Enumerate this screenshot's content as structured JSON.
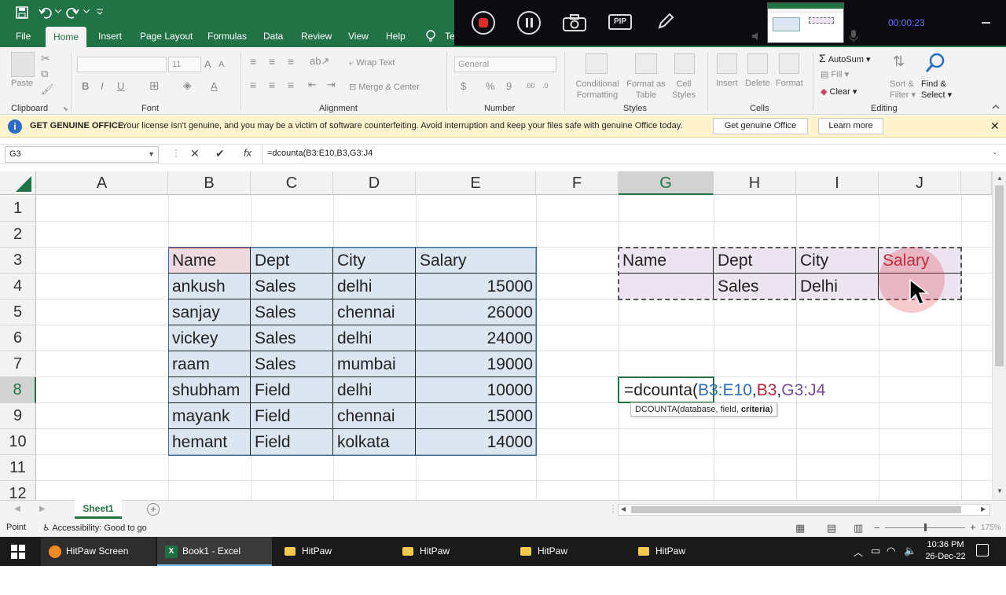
{
  "quick_access": {
    "save_icon": "save-icon",
    "undo_icon": "undo-icon",
    "redo_icon": "redo-icon"
  },
  "tabs": [
    "File",
    "Home",
    "Insert",
    "Page Layout",
    "Formulas",
    "Data",
    "Review",
    "View",
    "Help",
    "Te"
  ],
  "recorder": {
    "pip_label": "PIP",
    "timer": "00:00:23"
  },
  "ribbon": {
    "clipboard": {
      "label": "Clipboard",
      "paste": "Paste"
    },
    "font": {
      "label": "Font",
      "size": "11"
    },
    "alignment": {
      "label": "Alignment",
      "wrap": "Wrap Text",
      "merge": "Merge & Center"
    },
    "number": {
      "label": "Number",
      "format": "General"
    },
    "styles": {
      "label": "Styles",
      "conditional": "Conditional",
      "conditional2": "Formatting",
      "format_as": "Format as",
      "format_as2": "Table",
      "cell_styles": "Cell",
      "cell_styles2": "Styles"
    },
    "cells": {
      "label": "Cells",
      "insert": "Insert",
      "delete": "Delete",
      "format": "Format"
    },
    "editing": {
      "label": "Editing",
      "autosum": "AutoSum",
      "fill": "Fill",
      "clear": "Clear",
      "sort": "Sort &",
      "sort2": "Filter",
      "find": "Find &",
      "find2": "Select"
    }
  },
  "message": {
    "title": "GET GENUINE OFFICE",
    "text": "Your license isn't genuine, and you may be a victim of software counterfeiting. Avoid interruption and keep your files safe with genuine Office today.",
    "btn1": "Get genuine Office",
    "btn2": "Learn more"
  },
  "formula_bar": {
    "name_box": "G3",
    "formula": "=dcounta(B3:E10,B3,G3:J4"
  },
  "columns": [
    "A",
    "B",
    "C",
    "D",
    "E",
    "F",
    "G",
    "H",
    "I",
    "J"
  ],
  "rows": [
    "1",
    "2",
    "3",
    "4",
    "5",
    "6",
    "7",
    "8",
    "9",
    "10",
    "11",
    "12"
  ],
  "table": {
    "headers": [
      "Name",
      "Dept",
      "City",
      "Salary"
    ],
    "rows": [
      [
        "ankush",
        "Sales",
        "delhi",
        "15000"
      ],
      [
        "sanjay",
        "Sales",
        "chennai",
        "26000"
      ],
      [
        "vickey",
        "Sales",
        "delhi",
        "24000"
      ],
      [
        "raam",
        "Sales",
        "mumbai",
        "19000"
      ],
      [
        "shubham",
        "Field",
        "delhi",
        "10000"
      ],
      [
        "mayank",
        "Field",
        "chennai",
        "15000"
      ],
      [
        "hemant",
        "Field",
        "kolkata",
        "14000"
      ]
    ]
  },
  "criteria": {
    "headers": [
      "Name",
      "Dept",
      "City",
      "Salary"
    ],
    "row": [
      "",
      "Sales",
      "Delhi",
      ""
    ]
  },
  "edit_cell": {
    "prefix": "=dcounta(",
    "arg1": "B3:E10",
    "comma1": ",",
    "arg2": "B3",
    "comma2": ",",
    "arg3": "G3:J4"
  },
  "tooltip": {
    "fn": "DCOUNTA(database, field, ",
    "bold": "criteria",
    ")": ")"
  },
  "sheet": {
    "tab": "Sheet1"
  },
  "status": {
    "mode": "Point",
    "accessibility": "Accessibility: Good to go",
    "zoom": "175%"
  },
  "taskbar": {
    "items": [
      "HitPaw Screen Rec...",
      "Book1 - Excel",
      "HitPaw",
      "HitPaw",
      "HitPaw",
      "HitPaw"
    ],
    "time": "10:36 PM",
    "date": "26-Dec-22"
  },
  "colors": {
    "excel_green": "#217346",
    "table_fill": "#dce6f1",
    "criteria_fill": "#ece4f0",
    "arg_blue": "#2e6eb5",
    "arg_red": "#b0253a",
    "arg_purple": "#7b4a9e"
  }
}
